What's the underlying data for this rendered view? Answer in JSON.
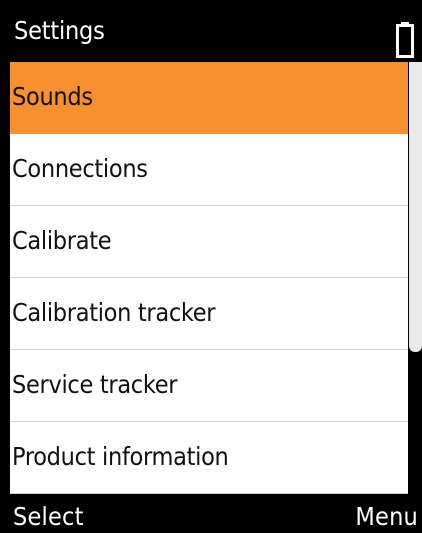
{
  "header": {
    "title": "Settings",
    "battery_icon": "battery-icon"
  },
  "menu": {
    "selected_index": 0,
    "items": [
      {
        "label": "Sounds"
      },
      {
        "label": "Connections"
      },
      {
        "label": "Calibrate"
      },
      {
        "label": "Calibration tracker"
      },
      {
        "label": "Service tracker"
      },
      {
        "label": "Product information"
      }
    ]
  },
  "softkeys": {
    "left": "Select",
    "right": "Menu"
  },
  "colors": {
    "selection": "#f7912f",
    "background": "#000000",
    "list_background": "#ffffff"
  }
}
